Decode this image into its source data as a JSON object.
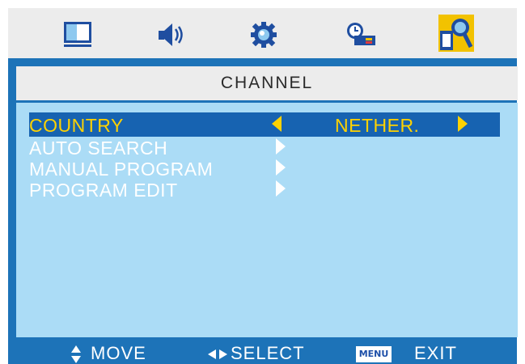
{
  "tabs": [
    {
      "icon": "picture-icon"
    },
    {
      "icon": "sound-icon"
    },
    {
      "icon": "setup-gear-icon"
    },
    {
      "icon": "time-icon"
    },
    {
      "icon": "channel-search-icon",
      "active": true
    }
  ],
  "header": {
    "title": "CHANNEL"
  },
  "menu": {
    "items": [
      {
        "label": "COUNTRY",
        "value": "NETHER."
      },
      {
        "label": "AUTO SEARCH"
      },
      {
        "label": "MANUAL PROGRAM"
      },
      {
        "label": "PROGRAM EDIT"
      }
    ]
  },
  "footer": {
    "move_label": "MOVE",
    "select_label": "SELECT",
    "menu_badge": "MENU",
    "exit_label": "EXIT"
  },
  "colors": {
    "frame": "#1d73b8",
    "content": "#abdcf6",
    "highlight": "#1763b1",
    "selected_text": "#ffd200",
    "header_bg": "#ececec"
  }
}
